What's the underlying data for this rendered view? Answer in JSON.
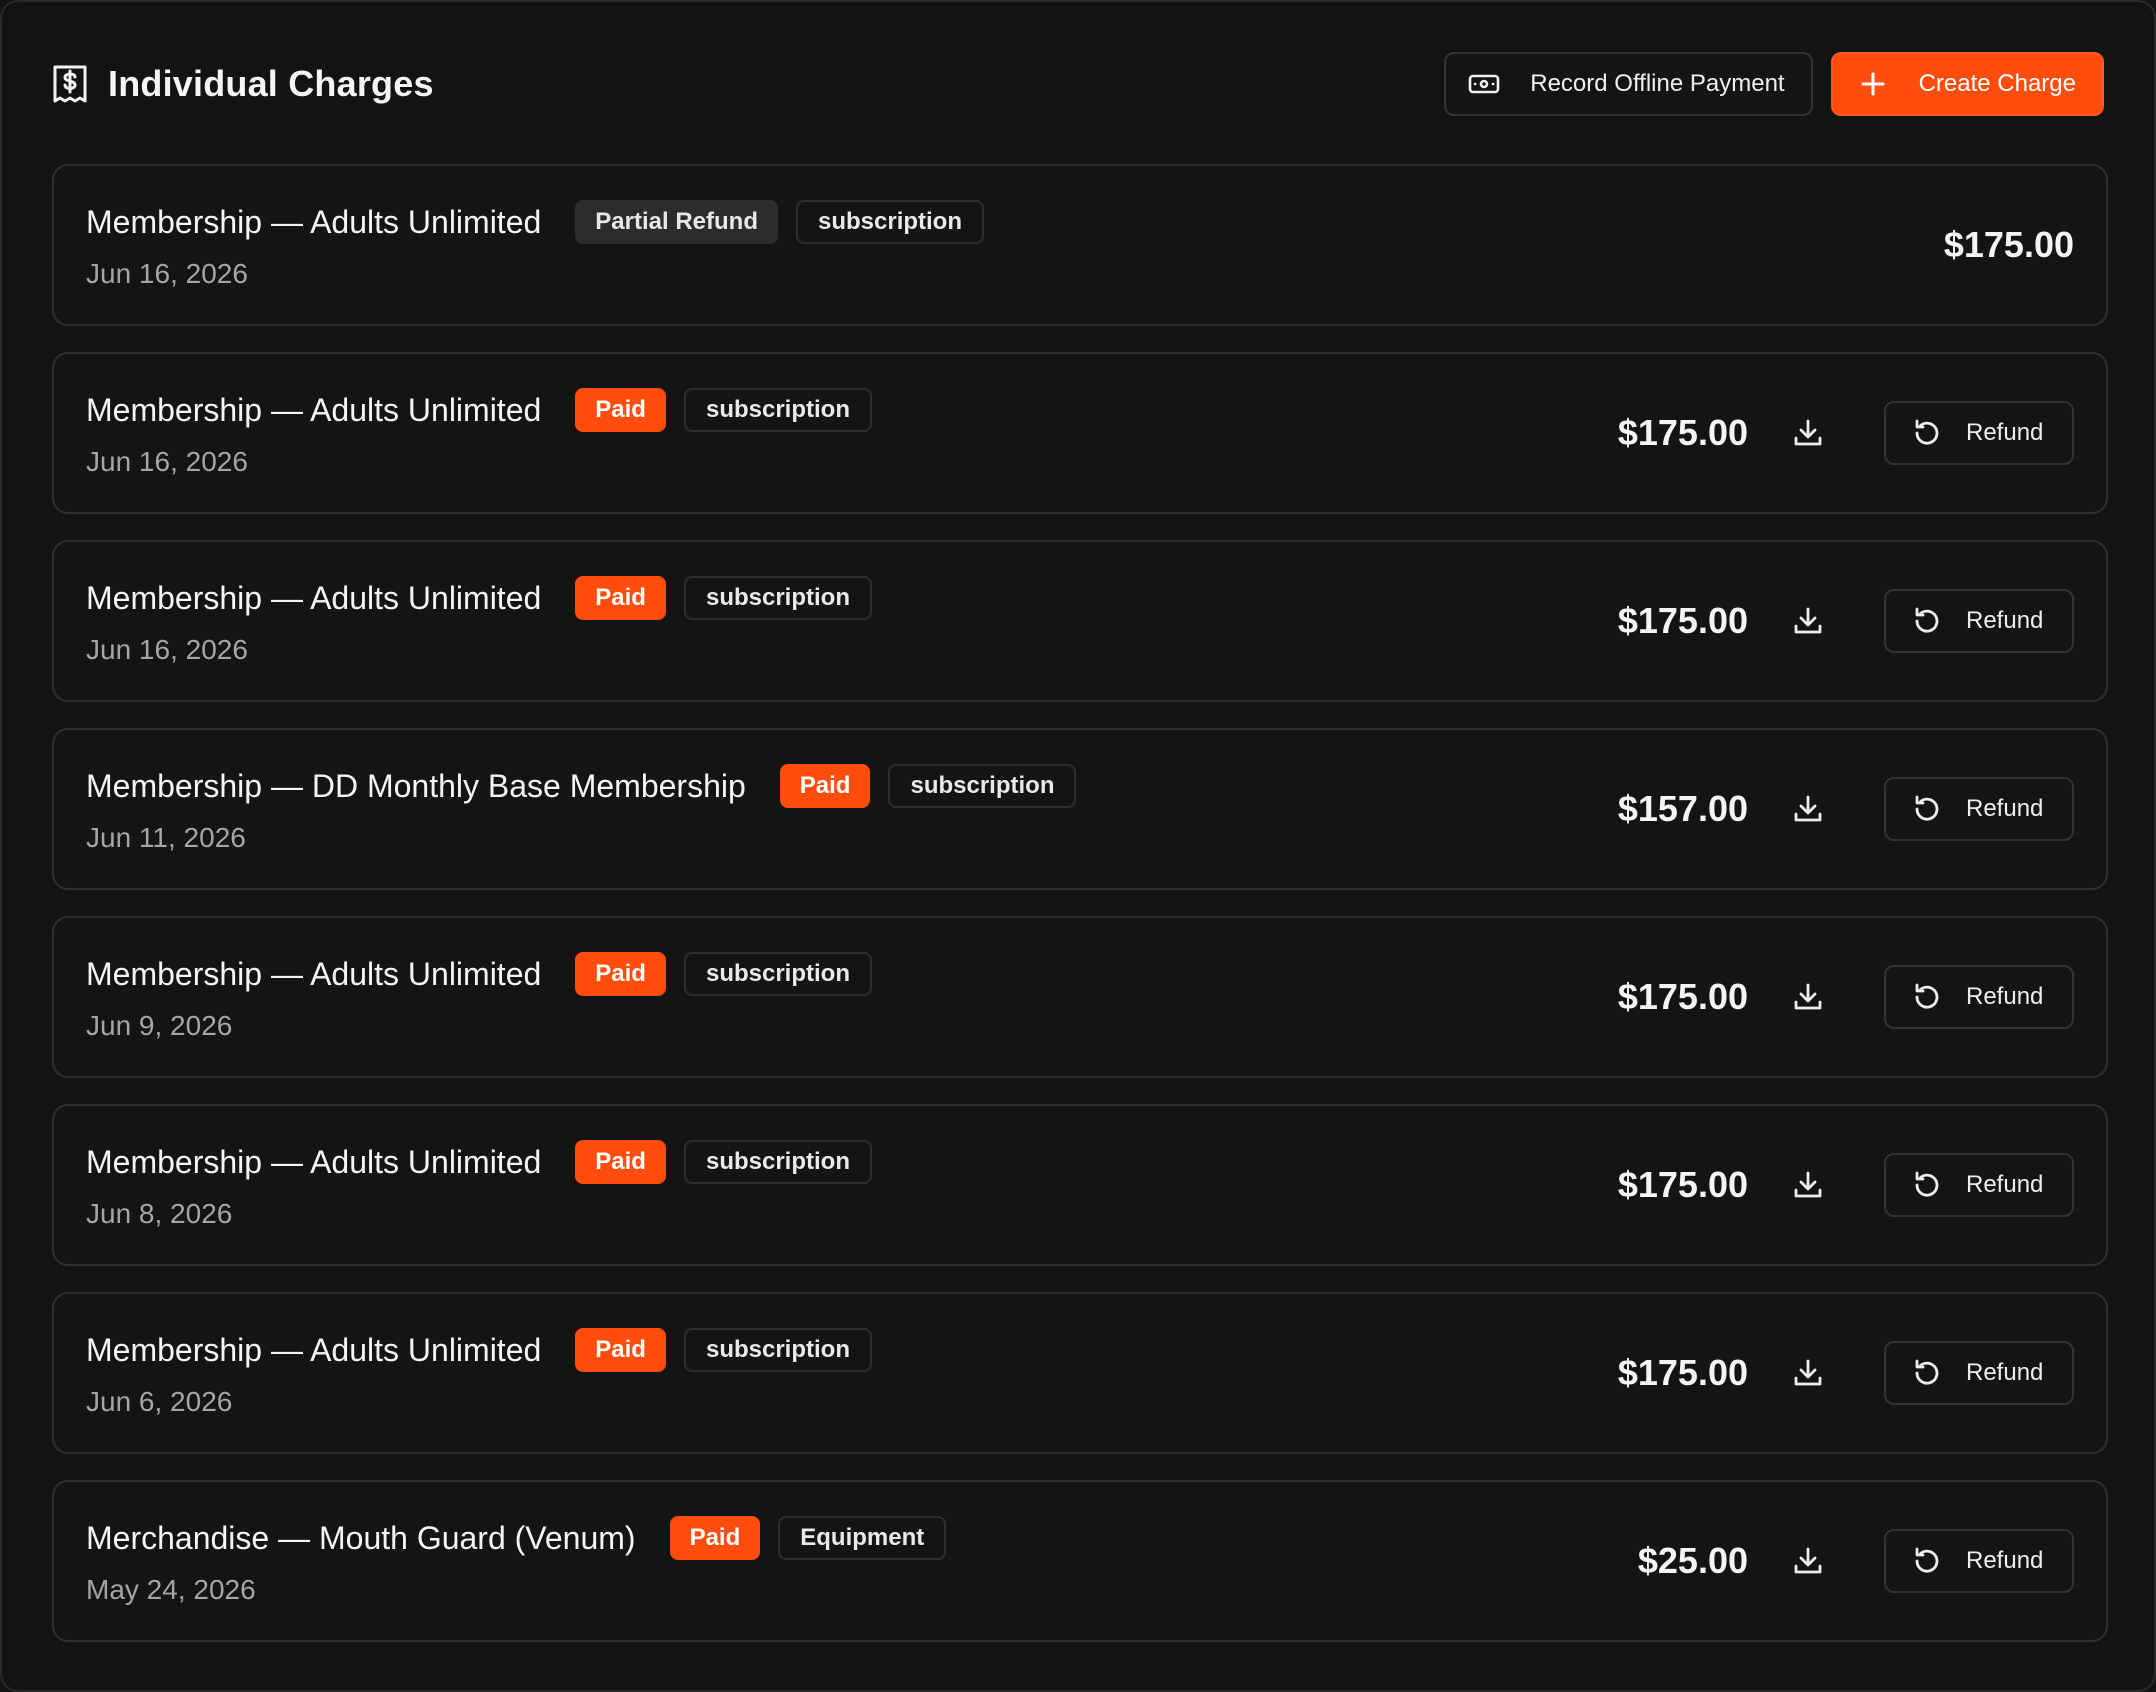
{
  "header": {
    "title": "Individual Charges",
    "record_offline_label": "Record Offline Payment",
    "create_charge_label": "Create Charge"
  },
  "refund_label": "Refund",
  "colors": {
    "accent": "#ff4d0d",
    "background": "#121212",
    "border": "#2e2e2e"
  },
  "charges": [
    {
      "title": "Membership — Adults Unlimited",
      "status": "Partial Refund",
      "status_kind": "partial",
      "type": "subscription",
      "date": "Jun 16, 2026",
      "amount": "$175.00",
      "actions": false
    },
    {
      "title": "Membership — Adults Unlimited",
      "status": "Paid",
      "status_kind": "paid",
      "type": "subscription",
      "date": "Jun 16, 2026",
      "amount": "$175.00",
      "actions": true
    },
    {
      "title": "Membership — Adults Unlimited",
      "status": "Paid",
      "status_kind": "paid",
      "type": "subscription",
      "date": "Jun 16, 2026",
      "amount": "$175.00",
      "actions": true
    },
    {
      "title": "Membership — DD Monthly Base Membership",
      "status": "Paid",
      "status_kind": "paid",
      "type": "subscription",
      "date": "Jun 11, 2026",
      "amount": "$157.00",
      "actions": true
    },
    {
      "title": "Membership — Adults Unlimited",
      "status": "Paid",
      "status_kind": "paid",
      "type": "subscription",
      "date": "Jun 9, 2026",
      "amount": "$175.00",
      "actions": true
    },
    {
      "title": "Membership — Adults Unlimited",
      "status": "Paid",
      "status_kind": "paid",
      "type": "subscription",
      "date": "Jun 8, 2026",
      "amount": "$175.00",
      "actions": true
    },
    {
      "title": "Membership — Adults Unlimited",
      "status": "Paid",
      "status_kind": "paid",
      "type": "subscription",
      "date": "Jun 6, 2026",
      "amount": "$175.00",
      "actions": true
    },
    {
      "title": "Merchandise — Mouth Guard (Venum)",
      "status": "Paid",
      "status_kind": "paid",
      "type": "Equipment",
      "date": "May 24, 2026",
      "amount": "$25.00",
      "actions": true
    }
  ]
}
